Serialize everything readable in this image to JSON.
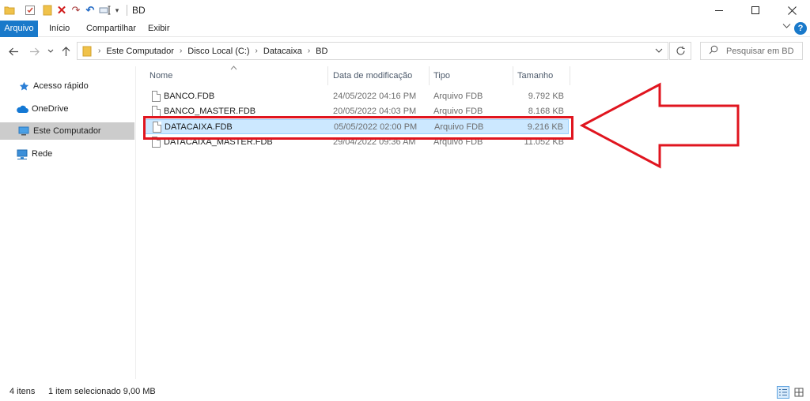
{
  "window": {
    "title": "BD",
    "controls": {
      "minimize": "—",
      "maximize": "☐",
      "close": "✕"
    }
  },
  "ribbon": {
    "tabs": [
      "Arquivo",
      "Início",
      "Compartilhar",
      "Exibir"
    ],
    "help": "?"
  },
  "nav": {
    "breadcrumbs": [
      "Este Computador",
      "Disco Local (C:)",
      "Datacaixa",
      "BD"
    ],
    "search_placeholder": "Pesquisar em BD"
  },
  "sidebar": {
    "items": [
      {
        "label": "Acesso rápido",
        "icon": "star-icon"
      },
      {
        "label": "OneDrive",
        "icon": "cloud-icon"
      },
      {
        "label": "Este Computador",
        "icon": "computer-icon",
        "selected": true
      },
      {
        "label": "Rede",
        "icon": "network-icon"
      }
    ]
  },
  "filelist": {
    "columns": [
      "Nome",
      "Data de modificação",
      "Tipo",
      "Tamanho"
    ],
    "rows": [
      {
        "name": "BANCO.FDB",
        "date": "24/05/2022 04:16 PM",
        "type": "Arquivo FDB",
        "size": "9.792 KB",
        "selected": false
      },
      {
        "name": "BANCO_MASTER.FDB",
        "date": "20/05/2022 04:03 PM",
        "type": "Arquivo FDB",
        "size": "8.168 KB",
        "selected": false
      },
      {
        "name": "DATACAIXA.FDB",
        "date": "05/05/2022 02:00 PM",
        "type": "Arquivo FDB",
        "size": "9.216 KB",
        "selected": true
      },
      {
        "name": "DATACAIXA_MASTER.FDB",
        "date": "29/04/2022 09:36 AM",
        "type": "Arquivo FDB",
        "size": "11.052 KB",
        "selected": false
      }
    ]
  },
  "status": {
    "count": "4 itens",
    "selection": "1 item selecionado  9,00 MB"
  },
  "colors": {
    "accent": "#1979ca",
    "selection_bg": "#cce8ff",
    "annotation_red": "#e0151f"
  }
}
